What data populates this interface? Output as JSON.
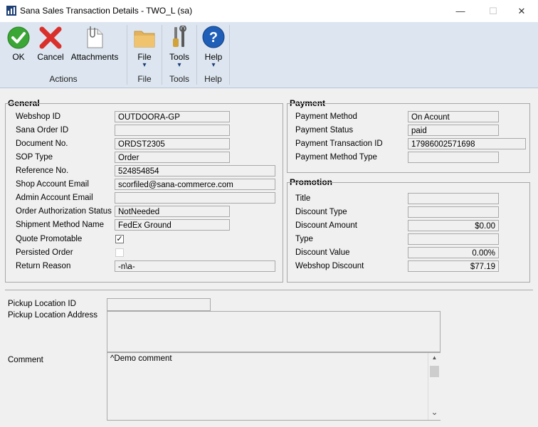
{
  "window": {
    "title": "Sana Sales Transaction Details  -  TWO_L (sa)",
    "minimize_glyph": "—",
    "maximize_glyph": "☐",
    "close_glyph": "✕"
  },
  "ribbon": {
    "ok_label": "OK",
    "cancel_label": "Cancel",
    "attachments_label": "Attachments",
    "actions_group": "Actions",
    "file_label": "File",
    "file_group": "File",
    "tools_label": "Tools",
    "tools_group": "Tools",
    "help_label": "Help",
    "help_group": "Help",
    "help_glyph": "?",
    "arrow_glyph": "▾"
  },
  "general": {
    "title": "General",
    "webshop_id_label": "Webshop ID",
    "webshop_id": "OUTDOORA-GP",
    "sana_order_id_label": "Sana Order ID",
    "sana_order_id": "",
    "document_no_label": "Document No.",
    "document_no": "ORDST2305",
    "sop_type_label": "SOP Type",
    "sop_type": "Order",
    "reference_no_label": "Reference No.",
    "reference_no": "524854854",
    "shop_email_label": "Shop Account Email",
    "shop_email": "scorfiled@sana-commerce.com",
    "admin_email_label": "Admin Account Email",
    "admin_email": "",
    "order_auth_label": "Order Authorization Status",
    "order_auth": "NotNeeded",
    "shipment_label": "Shipment Method Name",
    "shipment": "FedEx Ground",
    "quote_promotable_label": "Quote Promotable",
    "quote_check": "✓",
    "persisted_order_label": "Persisted Order",
    "return_reason_label": "Return Reason",
    "return_reason": "-n\\a-"
  },
  "payment": {
    "title": "Payment",
    "method_label": "Payment Method",
    "method": "On Acount",
    "status_label": "Payment Status",
    "status": "paid",
    "txn_label": "Payment Transaction ID",
    "txn": "17986002571698",
    "method_type_label": "Payment Method Type",
    "method_type": ""
  },
  "promotion": {
    "title": "Promotion",
    "title_label": "Title",
    "title_value": "",
    "discount_type_label": "Discount Type",
    "discount_type": "",
    "discount_amount_label": "Discount Amount",
    "discount_amount": "$0.00",
    "type_label": "Type",
    "type_value": "",
    "discount_value_label": "Discount Value",
    "discount_value": "0.00%",
    "webshop_discount_label": "Webshop Discount",
    "webshop_discount": "$77.19"
  },
  "bottom": {
    "pickup_id_label": "Pickup Location ID",
    "pickup_id": "",
    "pickup_address_label": "Pickup Location Address",
    "pickup_address": "",
    "comment_label": "Comment",
    "comment": "^Demo comment",
    "scroll_up": "▲",
    "scroll_down": "⌄"
  },
  "colors": {
    "ok_green": "#3aa635",
    "cancel_red": "#d9302c",
    "help_blue": "#1f5fb8",
    "ribbon_bg": "#dde6f0"
  }
}
